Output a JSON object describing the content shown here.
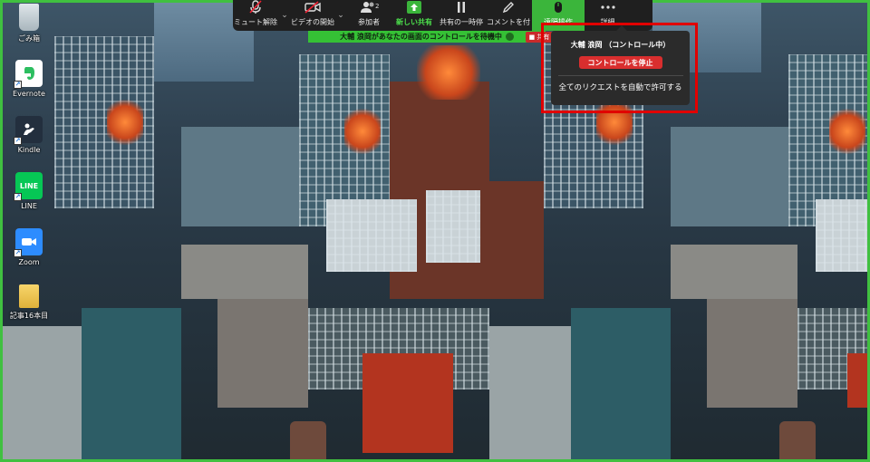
{
  "desktop": {
    "icons": [
      {
        "label": "ごみ箱",
        "icon": "recycle-bin-icon"
      },
      {
        "label": "Evernote",
        "icon": "evernote-icon"
      },
      {
        "label": "Kindle",
        "icon": "kindle-icon"
      },
      {
        "label": "LINE",
        "icon": "line-icon",
        "glyph": "LINE"
      },
      {
        "label": "Zoom",
        "icon": "zoom-icon"
      },
      {
        "label": "記事16本目",
        "icon": "folder-icon"
      }
    ]
  },
  "toolbar": {
    "mute": {
      "label": "ミュート解除",
      "icon": "microphone-muted-icon"
    },
    "video": {
      "label": "ビデオの開始",
      "icon": "video-off-icon"
    },
    "participants": {
      "label": "参加者",
      "icon": "participants-icon",
      "count": "2"
    },
    "new_share": {
      "label": "新しい共有",
      "icon": "share-screen-icon"
    },
    "pause_share": {
      "label": "共有の一時停",
      "icon": "pause-icon"
    },
    "annotate": {
      "label": "コメントを付",
      "icon": "pencil-icon"
    },
    "remote_control": {
      "label": "遠隔操作",
      "icon": "mouse-icon"
    },
    "more": {
      "label": "詳細",
      "icon": "more-dots-icon"
    }
  },
  "status_banner": {
    "text": "大輔 浪岡があなたの画面のコントロールを待機中"
  },
  "stop_chip": {
    "text": "■ 共有"
  },
  "popup": {
    "title": "大輔 浪岡 （コントロール中）",
    "stop_button": "コントロールを停止",
    "auto_allow": "全てのリクエストを自動で許可する"
  },
  "colors": {
    "share_green": "#3bb53b",
    "stop_red": "#d92e2e",
    "highlight_red": "#e10000"
  }
}
